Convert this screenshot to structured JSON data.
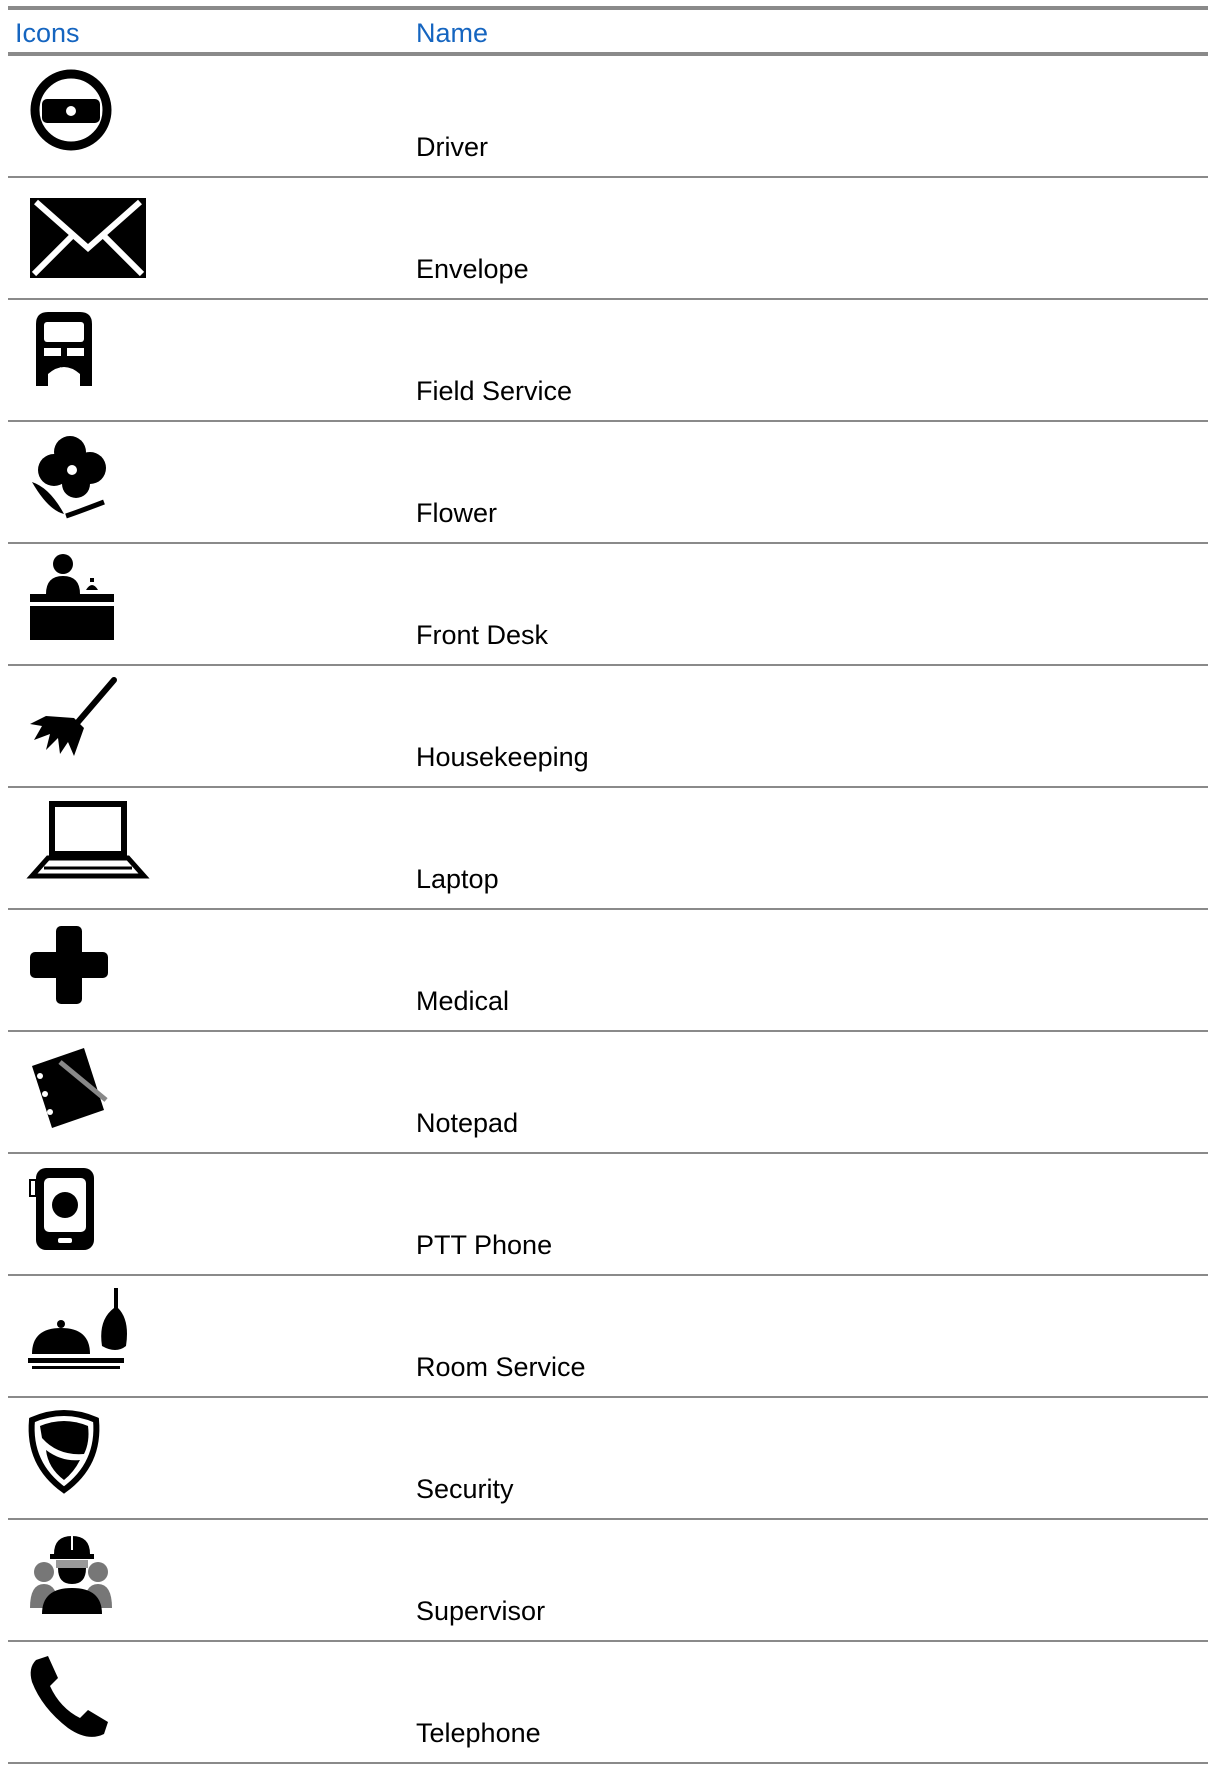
{
  "table": {
    "headers": {
      "icons": "Icons",
      "name": "Name"
    },
    "rows": [
      {
        "icon": "driver-icon",
        "name": "Driver"
      },
      {
        "icon": "envelope-icon",
        "name": "Envelope"
      },
      {
        "icon": "field-service-icon",
        "name": "Field Service"
      },
      {
        "icon": "flower-icon",
        "name": "Flower"
      },
      {
        "icon": "front-desk-icon",
        "name": "Front Desk"
      },
      {
        "icon": "housekeeping-icon",
        "name": "Housekeeping"
      },
      {
        "icon": "laptop-icon",
        "name": "Laptop"
      },
      {
        "icon": "medical-icon",
        "name": "Medical"
      },
      {
        "icon": "notepad-icon",
        "name": "Notepad"
      },
      {
        "icon": "ptt-phone-icon",
        "name": "PTT Phone"
      },
      {
        "icon": "room-service-icon",
        "name": "Room Service"
      },
      {
        "icon": "security-icon",
        "name": "Security"
      },
      {
        "icon": "supervisor-icon",
        "name": "Supervisor"
      },
      {
        "icon": "telephone-icon",
        "name": "Telephone"
      }
    ]
  },
  "colors": {
    "header_text": "#1565c0",
    "rule": "#8a8a8a",
    "text": "#000000"
  }
}
